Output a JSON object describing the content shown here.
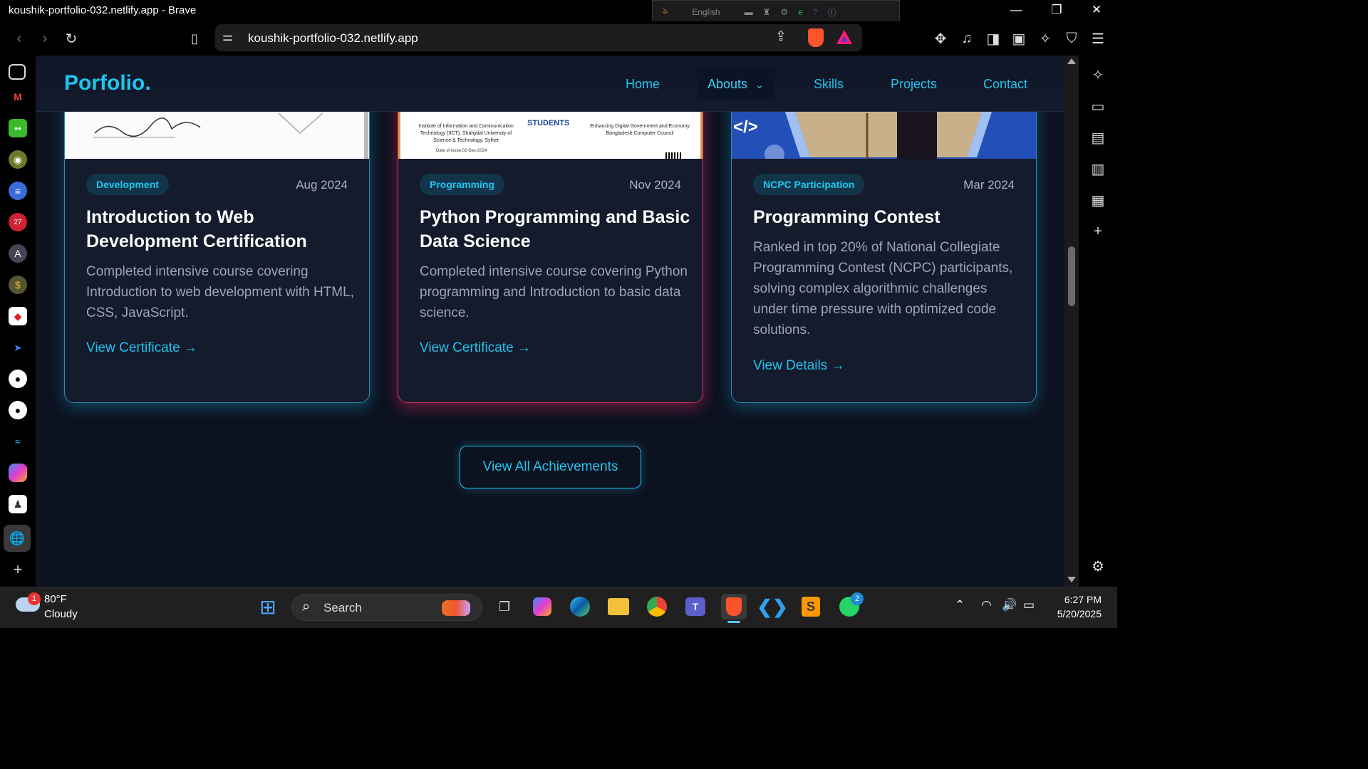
{
  "window": {
    "title": "koushik-portfolio-032.netlify.app - Brave",
    "lang": "English"
  },
  "urlbar": {
    "url": "koushik-portfolio-032.netlify.app"
  },
  "site": {
    "logo": "Porfolio.",
    "nav": [
      "Home",
      "Abouts",
      "Skills",
      "Projects",
      "Contact"
    ],
    "cards": [
      {
        "tag": "Development",
        "date": "Aug 2024",
        "title": "Introduction to Web Development Certification",
        "desc": "Completed intensive course covering Introduction to web development with HTML, CSS, JavaScript.",
        "link": "View Certificate →"
      },
      {
        "tag": "Programming",
        "date": "Nov 2024",
        "title": "Python Programming and Basic Data Science",
        "desc": "Completed intensive course covering Python programming and Introduction to basic data science.",
        "link": "View Certificate →",
        "cert_left": "Institute of Information and Communication Technology (IICT), Shahjalal University of Science & Technology, Sylhet",
        "cert_right": "Enhancing Digital Government and Economy Bangladesh Computer Council",
        "cert_mid": "STUDENTS",
        "cert_date": "Date of issue:02-Dec-2024"
      },
      {
        "tag": "NCPC Participation",
        "date": "Mar 2024",
        "title": "Programming Contest",
        "desc": "Ranked in top 20% of National Collegiate Programming Contest (NCPC) participants, solving complex algorithmic challenges under time pressure with optimized code solutions.",
        "link": "View Details →",
        "code_glyph": "</>"
      }
    ],
    "view_all": "View All Achievements"
  },
  "taskbar": {
    "weather_temp": "80°F",
    "weather_cond": "Cloudy",
    "weather_badge": "1",
    "search": "Search",
    "whatsapp_badge": "2",
    "time": "6:27 PM",
    "date": "5/20/2025"
  },
  "colors": {
    "accent": "#22c4ee",
    "bg": "#0d1220",
    "card": "#141b2c",
    "pink": "#d0336a"
  }
}
